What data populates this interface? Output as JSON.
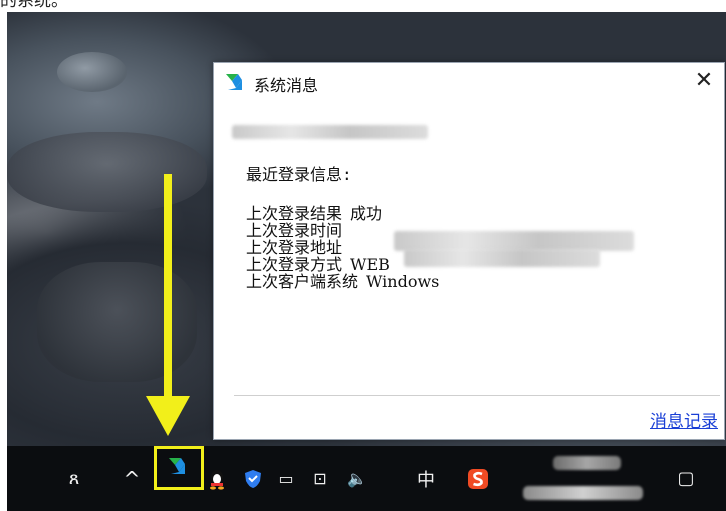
{
  "caption": "的系统。",
  "popup": {
    "title": "系统消息",
    "close_glyph": "✕",
    "recent_label": "最近登录信息:",
    "rows": [
      {
        "label": "上次登录结果",
        "value": "成功"
      },
      {
        "label": "上次登录时间",
        "value": ""
      },
      {
        "label": "上次登录地址",
        "value": ""
      },
      {
        "label": "上次登录方式",
        "value": "WEB"
      },
      {
        "label": "上次客户端系统",
        "value": "Windows"
      }
    ],
    "history_link": "消息记录"
  },
  "taskbar": {
    "people_glyph": "ጸ",
    "chevron_glyph": "^",
    "battery_glyph": "▭",
    "network_glyph": "⊡",
    "volume_glyph": "🔈",
    "ime_label": "中",
    "notify_glyph": "▢"
  },
  "colors": {
    "arrow": "#f2ef1a",
    "link": "#1a3fd6",
    "logo_green": "#27b24a",
    "logo_blue": "#1e8fe1",
    "sogou": "#f04b24"
  },
  "icons": [
    "people-icon",
    "show-hidden-icons-chevron",
    "app-tray-icon",
    "qq-icon",
    "security-shield-icon",
    "battery-icon",
    "network-icon",
    "volume-icon",
    "input-method-icon",
    "sogou-icon",
    "notification-icon",
    "close-icon"
  ]
}
